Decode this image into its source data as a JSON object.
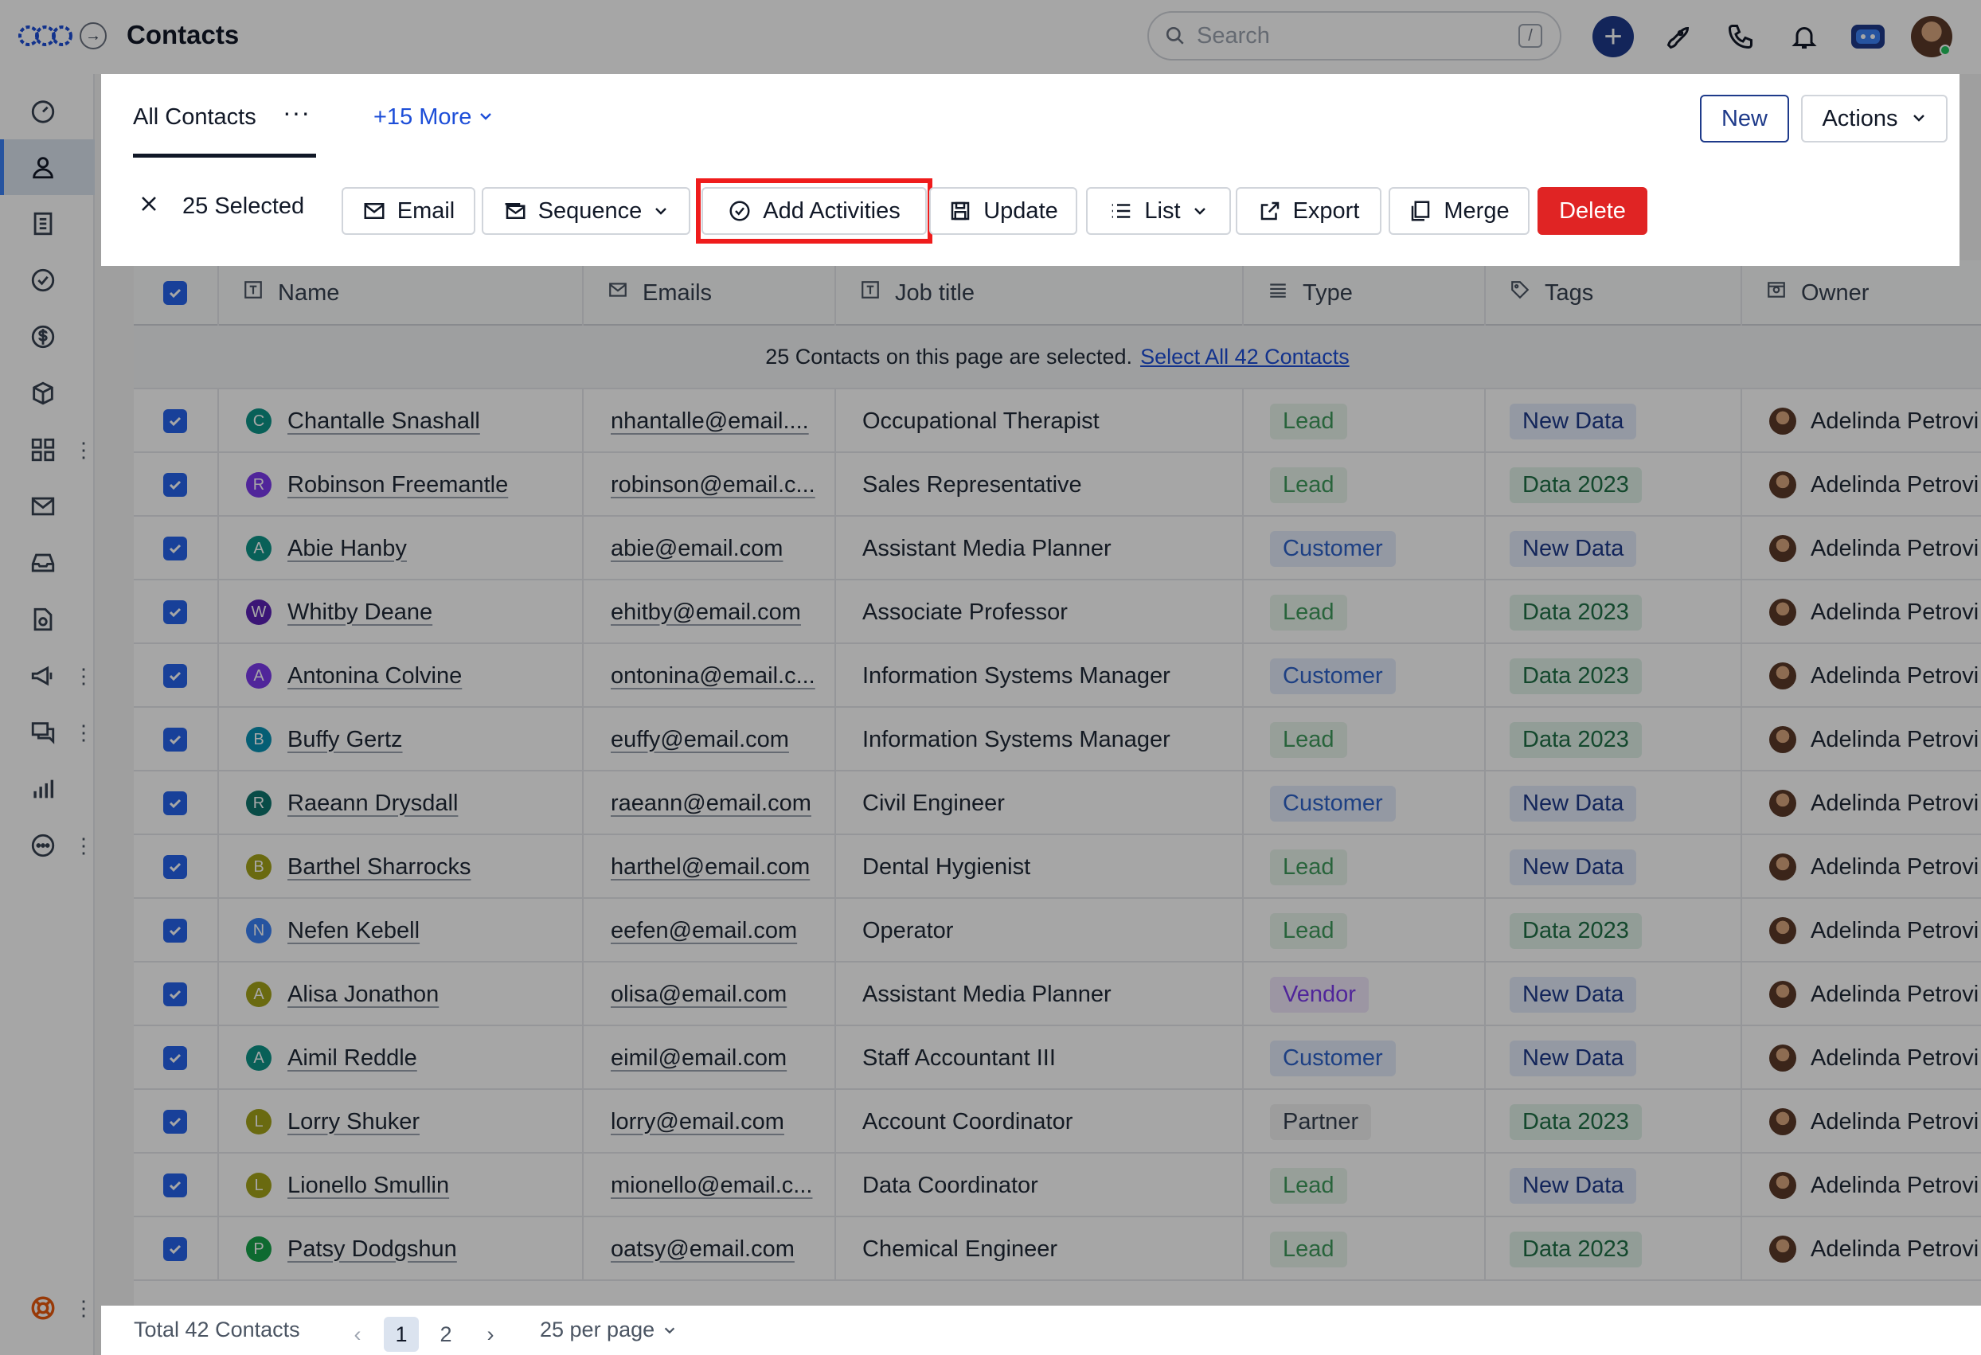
{
  "app": {
    "title": "Contacts"
  },
  "search": {
    "placeholder": "Search",
    "shortcut": "/"
  },
  "header": {
    "view_tab": "All Contacts",
    "more_views": "+15 More",
    "new_label": "New",
    "actions_label": "Actions"
  },
  "toolbar": {
    "selected_label": "25 Selected",
    "email": "Email",
    "sequence": "Sequence",
    "add_activities": "Add Activities",
    "update": "Update",
    "list": "List",
    "export": "Export",
    "merge": "Merge",
    "delete": "Delete"
  },
  "table": {
    "columns": {
      "name": "Name",
      "emails": "Emails",
      "job_title": "Job title",
      "type": "Type",
      "tags": "Tags",
      "owner": "Owner"
    },
    "banner_text": "25 Contacts on this page are selected.",
    "banner_link": "Select All 42 Contacts",
    "rows": [
      {
        "initial": "C",
        "color": "#0d9488",
        "name": "Chantalle Snashall",
        "email": "nhantalle@email....",
        "job": "Occupational Therapist",
        "type": "Lead",
        "type_class": "b-lead",
        "tag": "New Data",
        "tag_class": "t-new",
        "owner": "Adelinda Petrovi"
      },
      {
        "initial": "R",
        "color": "#7c3aed",
        "name": "Robinson Freemantle",
        "email": "robinson@email.c...",
        "job": "Sales Representative",
        "type": "Lead",
        "type_class": "b-lead",
        "tag": "Data 2023",
        "tag_class": "t-2023",
        "owner": "Adelinda Petrovi"
      },
      {
        "initial": "A",
        "color": "#0d9488",
        "name": "Abie Hanby",
        "email": "abie@email.com",
        "job": "Assistant Media Planner",
        "type": "Customer",
        "type_class": "b-customer",
        "tag": "New Data",
        "tag_class": "t-new",
        "owner": "Adelinda Petrovi"
      },
      {
        "initial": "W",
        "color": "#5b21b6",
        "name": "Whitby Deane",
        "email": "ehitby@email.com",
        "job": "Associate Professor",
        "type": "Lead",
        "type_class": "b-lead",
        "tag": "Data 2023",
        "tag_class": "t-2023",
        "owner": "Adelinda Petrovi"
      },
      {
        "initial": "A",
        "color": "#7c3aed",
        "name": "Antonina Colvine",
        "email": "ontonina@email.c...",
        "job": "Information Systems Manager",
        "type": "Customer",
        "type_class": "b-customer",
        "tag": "Data 2023",
        "tag_class": "t-2023",
        "owner": "Adelinda Petrovi"
      },
      {
        "initial": "B",
        "color": "#0891b2",
        "name": "Buffy Gertz",
        "email": "euffy@email.com",
        "job": "Information Systems Manager",
        "type": "Lead",
        "type_class": "b-lead",
        "tag": "Data 2023",
        "tag_class": "t-2023",
        "owner": "Adelinda Petrovi"
      },
      {
        "initial": "R",
        "color": "#0f766e",
        "name": "Raeann Drysdall",
        "email": "raeann@email.com",
        "job": "Civil Engineer",
        "type": "Customer",
        "type_class": "b-customer",
        "tag": "New Data",
        "tag_class": "t-new",
        "owner": "Adelinda Petrovi"
      },
      {
        "initial": "B",
        "color": "#a3a31a",
        "name": "Barthel Sharrocks",
        "email": "harthel@email.com",
        "job": "Dental Hygienist",
        "type": "Lead",
        "type_class": "b-lead",
        "tag": "New Data",
        "tag_class": "t-new",
        "owner": "Adelinda Petrovi"
      },
      {
        "initial": "N",
        "color": "#3b82f6",
        "name": "Nefen Kebell",
        "email": "eefen@email.com",
        "job": "Operator",
        "type": "Lead",
        "type_class": "b-lead",
        "tag": "Data 2023",
        "tag_class": "t-2023",
        "owner": "Adelinda Petrovi"
      },
      {
        "initial": "A",
        "color": "#a3a31a",
        "name": "Alisa Jonathon",
        "email": "olisa@email.com",
        "job": "Assistant Media Planner",
        "type": "Vendor",
        "type_class": "b-vendor",
        "tag": "New Data",
        "tag_class": "t-new",
        "owner": "Adelinda Petrovi"
      },
      {
        "initial": "A",
        "color": "#0d9488",
        "name": "Aimil Reddle",
        "email": "eimil@email.com",
        "job": "Staff Accountant III",
        "type": "Customer",
        "type_class": "b-customer",
        "tag": "New Data",
        "tag_class": "t-new",
        "owner": "Adelinda Petrovi"
      },
      {
        "initial": "L",
        "color": "#a3a31a",
        "name": "Lorry Shuker",
        "email": "lorry@email.com",
        "job": "Account Coordinator",
        "type": "Partner",
        "type_class": "b-partner",
        "tag": "Data 2023",
        "tag_class": "t-2023",
        "owner": "Adelinda Petrovi"
      },
      {
        "initial": "L",
        "color": "#a3a31a",
        "name": "Lionello Smullin",
        "email": "mionello@email.c...",
        "job": "Data Coordinator",
        "type": "Lead",
        "type_class": "b-lead",
        "tag": "New Data",
        "tag_class": "t-new",
        "owner": "Adelinda Petrovi"
      },
      {
        "initial": "P",
        "color": "#16a34a",
        "name": "Patsy Dodgshun",
        "email": "oatsy@email.com",
        "job": "Chemical Engineer",
        "type": "Lead",
        "type_class": "b-lead",
        "tag": "Data 2023",
        "tag_class": "t-2023",
        "owner": "Adelinda Petrovi"
      }
    ]
  },
  "footer": {
    "total": "Total 42 Contacts",
    "page_current": "1",
    "page_next": "2",
    "per_page": "25 per page"
  }
}
